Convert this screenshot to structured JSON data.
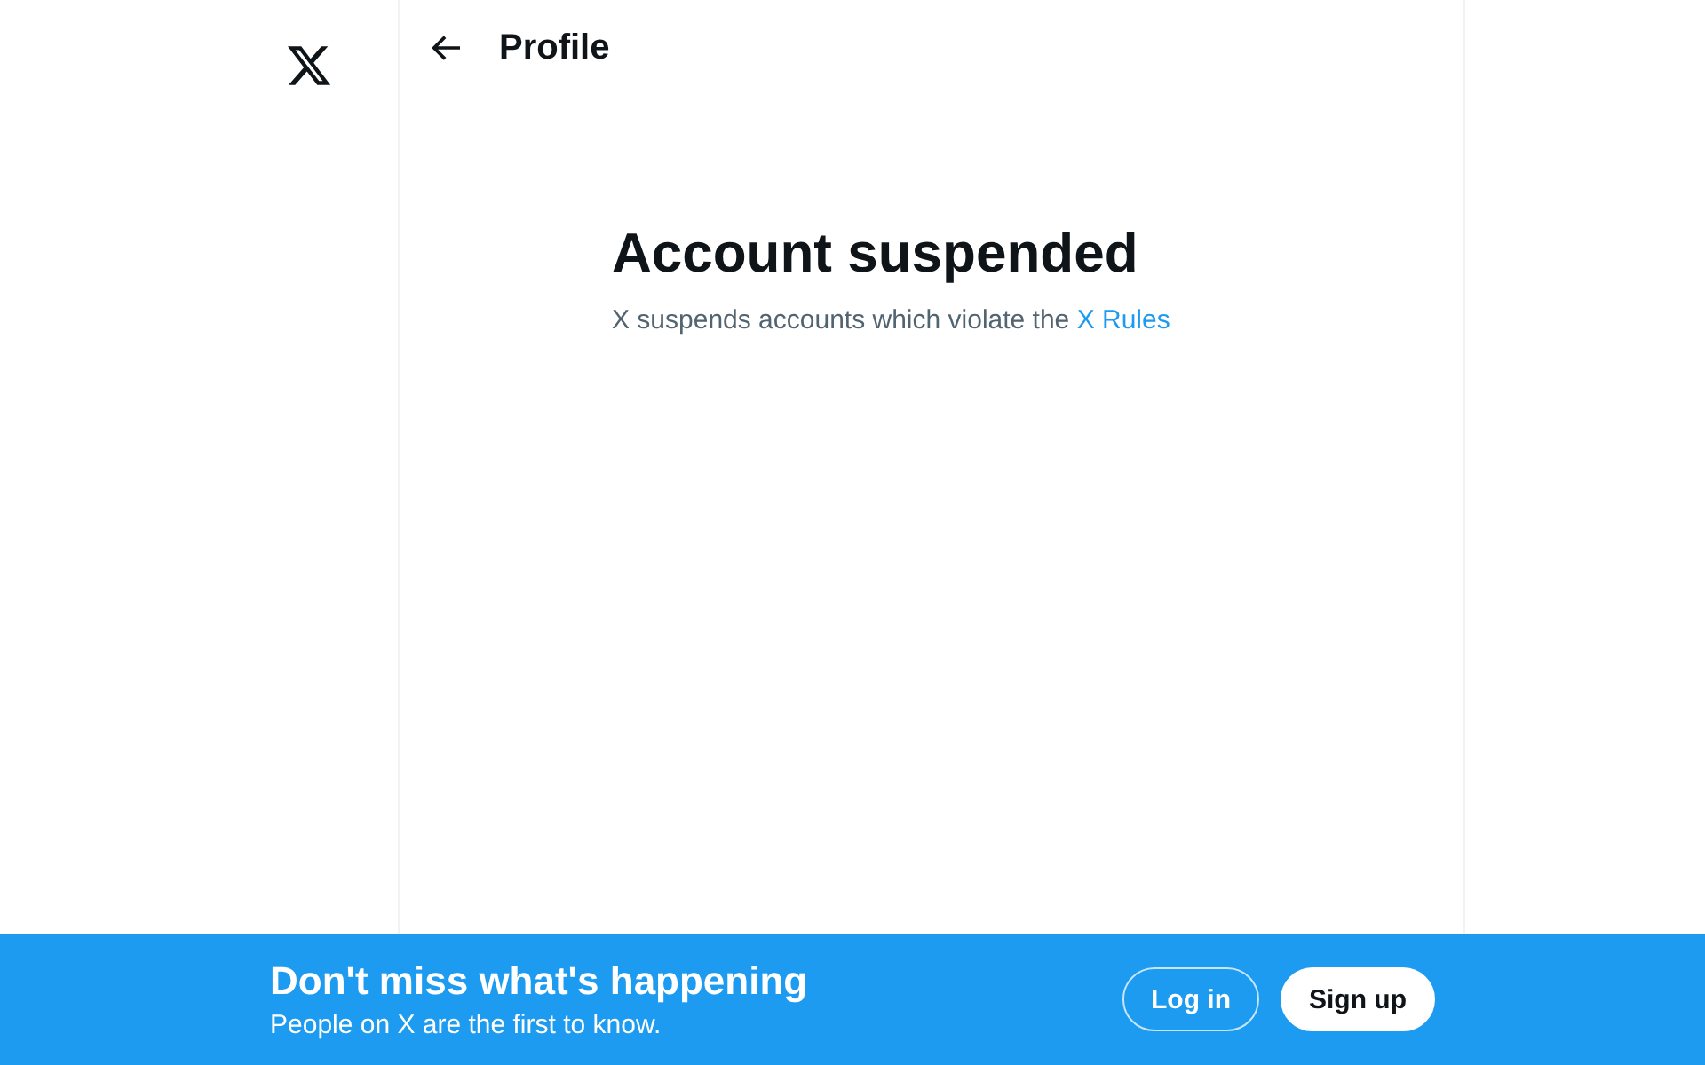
{
  "header": {
    "title": "Profile"
  },
  "empty_state": {
    "title": "Account suspended",
    "message": "X suspends accounts which violate the",
    "link": "X Rules"
  },
  "bottom_bar": {
    "title": "Don't miss what's happening",
    "subtitle": "People on X are the first to know.",
    "buttons": [
      {
        "label": "Log in",
        "kind": "outline"
      },
      {
        "label": "Sign up",
        "kind": "filled"
      }
    ]
  }
}
